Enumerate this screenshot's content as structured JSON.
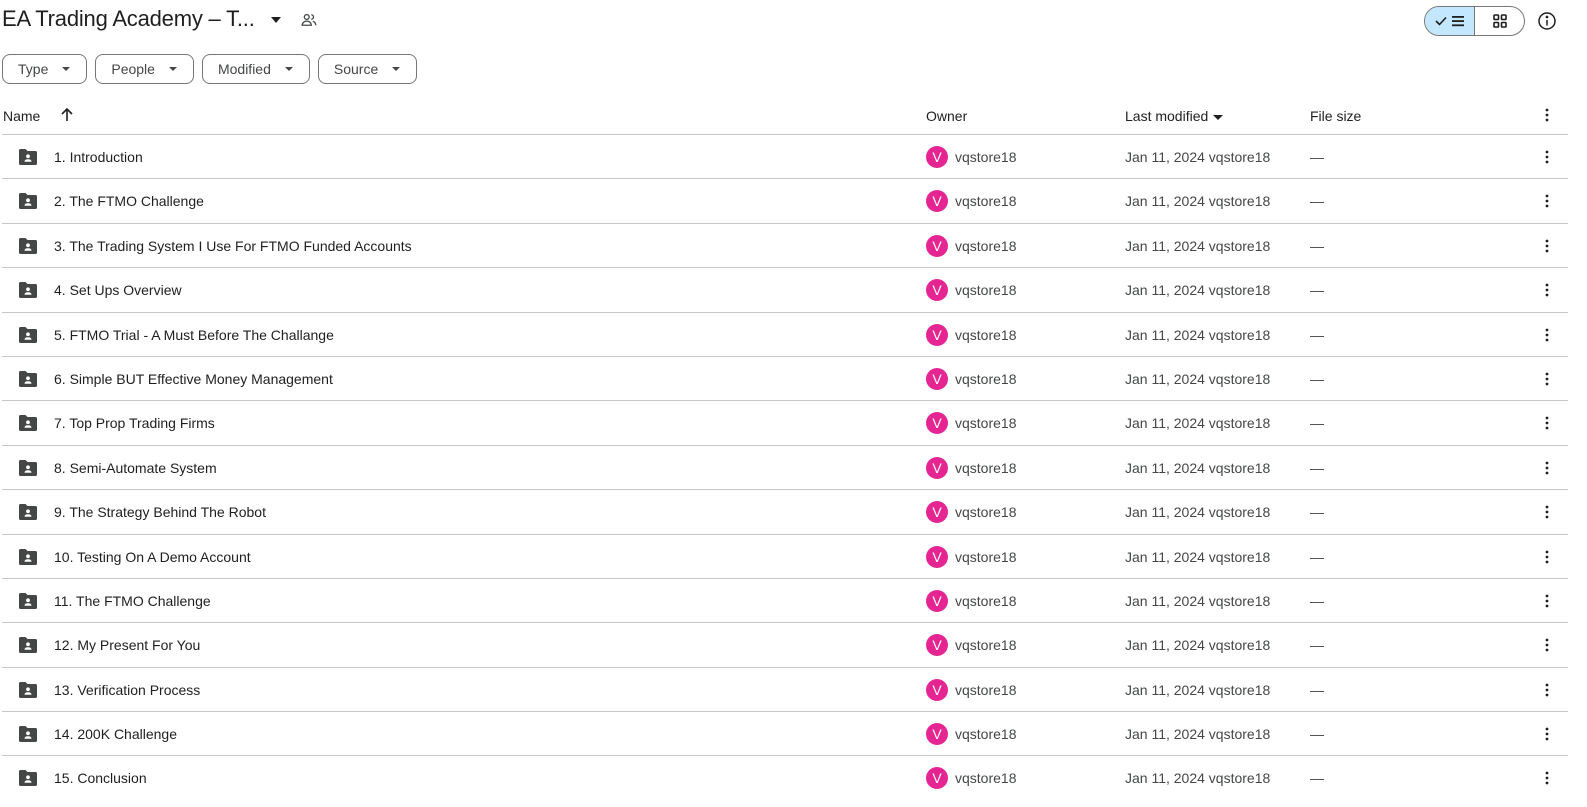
{
  "header": {
    "title": "EA Trading Academy – T...",
    "icons": {
      "title_dropdown": "caret-down-icon",
      "shared": "people-icon",
      "list_view": "check-list-icon",
      "grid_view": "grid-icon",
      "info": "info-icon"
    },
    "view_mode": "list"
  },
  "filters": [
    {
      "label": "Type"
    },
    {
      "label": "People"
    },
    {
      "label": "Modified"
    },
    {
      "label": "Source"
    }
  ],
  "table": {
    "columns": {
      "name": "Name",
      "owner": "Owner",
      "last_modified": "Last modified",
      "file_size": "File size"
    },
    "sort": {
      "column": "name",
      "direction": "ascending"
    },
    "rows": [
      {
        "name": "1. Introduction",
        "avatar": "V",
        "owner": "vqstore18",
        "modified": "Jan 11, 2024 vqstore18",
        "size": "—"
      },
      {
        "name": "2. The FTMO Challenge",
        "avatar": "V",
        "owner": "vqstore18",
        "modified": "Jan 11, 2024 vqstore18",
        "size": "—"
      },
      {
        "name": "3. The Trading System I Use For FTMO Funded Accounts",
        "avatar": "V",
        "owner": "vqstore18",
        "modified": "Jan 11, 2024 vqstore18",
        "size": "—"
      },
      {
        "name": "4. Set Ups Overview",
        "avatar": "V",
        "owner": "vqstore18",
        "modified": "Jan 11, 2024 vqstore18",
        "size": "—"
      },
      {
        "name": "5. FTMO Trial - A Must Before The Challange",
        "avatar": "V",
        "owner": "vqstore18",
        "modified": "Jan 11, 2024 vqstore18",
        "size": "—"
      },
      {
        "name": "6. Simple BUT Effective Money Management",
        "avatar": "V",
        "owner": "vqstore18",
        "modified": "Jan 11, 2024 vqstore18",
        "size": "—"
      },
      {
        "name": "7. Top Prop Trading Firms",
        "avatar": "V",
        "owner": "vqstore18",
        "modified": "Jan 11, 2024 vqstore18",
        "size": "—"
      },
      {
        "name": "8. Semi-Automate System",
        "avatar": "V",
        "owner": "vqstore18",
        "modified": "Jan 11, 2024 vqstore18",
        "size": "—"
      },
      {
        "name": "9. The Strategy Behind The Robot",
        "avatar": "V",
        "owner": "vqstore18",
        "modified": "Jan 11, 2024 vqstore18",
        "size": "—"
      },
      {
        "name": "10. Testing On A Demo Account",
        "avatar": "V",
        "owner": "vqstore18",
        "modified": "Jan 11, 2024 vqstore18",
        "size": "—"
      },
      {
        "name": "11. The FTMO Challenge",
        "avatar": "V",
        "owner": "vqstore18",
        "modified": "Jan 11, 2024 vqstore18",
        "size": "—"
      },
      {
        "name": "12. My Present For You",
        "avatar": "V",
        "owner": "vqstore18",
        "modified": "Jan 11, 2024 vqstore18",
        "size": "—"
      },
      {
        "name": "13. Verification Process",
        "avatar": "V",
        "owner": "vqstore18",
        "modified": "Jan 11, 2024 vqstore18",
        "size": "—"
      },
      {
        "name": "14. 200K Challenge",
        "avatar": "V",
        "owner": "vqstore18",
        "modified": "Jan 11, 2024 vqstore18",
        "size": "—"
      },
      {
        "name": "15. Conclusion",
        "avatar": "V",
        "owner": "vqstore18",
        "modified": "Jan 11, 2024 vqstore18",
        "size": "—"
      }
    ]
  },
  "colors": {
    "avatar": "#e52592",
    "view_toggle_active": "#c2e7ff",
    "folder_icon": "#444746"
  }
}
